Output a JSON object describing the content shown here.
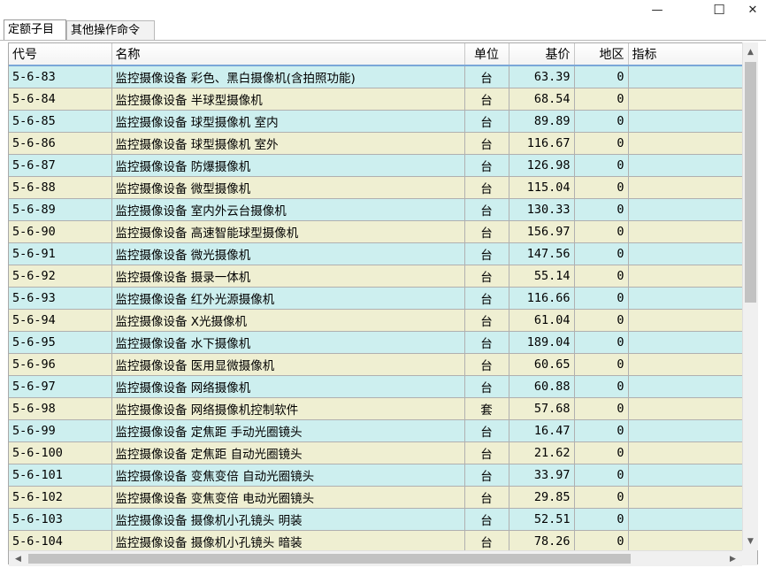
{
  "window": {
    "minimize_glyph": "—",
    "maximize_glyph": "☐",
    "close_glyph": "✕"
  },
  "tabs": [
    {
      "label": "定额子目",
      "active": true
    },
    {
      "label": "其他操作命令",
      "active": false
    }
  ],
  "grid": {
    "columns": [
      "代号",
      "名称",
      "单位",
      "基价",
      "地区",
      "指标"
    ],
    "rows": [
      {
        "code": "5-6-83",
        "name": "监控摄像设备 彩色、黑白摄像机(含拍照功能)",
        "unit": "台",
        "price": "63.39",
        "region": "0",
        "index": ""
      },
      {
        "code": "5-6-84",
        "name": "监控摄像设备 半球型摄像机",
        "unit": "台",
        "price": "68.54",
        "region": "0",
        "index": ""
      },
      {
        "code": "5-6-85",
        "name": "监控摄像设备 球型摄像机 室内",
        "unit": "台",
        "price": "89.89",
        "region": "0",
        "index": ""
      },
      {
        "code": "5-6-86",
        "name": "监控摄像设备 球型摄像机 室外",
        "unit": "台",
        "price": "116.67",
        "region": "0",
        "index": ""
      },
      {
        "code": "5-6-87",
        "name": "监控摄像设备 防爆摄像机",
        "unit": "台",
        "price": "126.98",
        "region": "0",
        "index": ""
      },
      {
        "code": "5-6-88",
        "name": "监控摄像设备 微型摄像机",
        "unit": "台",
        "price": "115.04",
        "region": "0",
        "index": ""
      },
      {
        "code": "5-6-89",
        "name": "监控摄像设备 室内外云台摄像机",
        "unit": "台",
        "price": "130.33",
        "region": "0",
        "index": ""
      },
      {
        "code": "5-6-90",
        "name": "监控摄像设备 高速智能球型摄像机",
        "unit": "台",
        "price": "156.97",
        "region": "0",
        "index": ""
      },
      {
        "code": "5-6-91",
        "name": "监控摄像设备 微光摄像机",
        "unit": "台",
        "price": "147.56",
        "region": "0",
        "index": ""
      },
      {
        "code": "5-6-92",
        "name": "监控摄像设备 摄录一体机",
        "unit": "台",
        "price": "55.14",
        "region": "0",
        "index": ""
      },
      {
        "code": "5-6-93",
        "name": "监控摄像设备 红外光源摄像机",
        "unit": "台",
        "price": "116.66",
        "region": "0",
        "index": ""
      },
      {
        "code": "5-6-94",
        "name": "监控摄像设备 X光摄像机",
        "unit": "台",
        "price": "61.04",
        "region": "0",
        "index": ""
      },
      {
        "code": "5-6-95",
        "name": "监控摄像设备 水下摄像机",
        "unit": "台",
        "price": "189.04",
        "region": "0",
        "index": ""
      },
      {
        "code": "5-6-96",
        "name": "监控摄像设备 医用显微摄像机",
        "unit": "台",
        "price": "60.65",
        "region": "0",
        "index": ""
      },
      {
        "code": "5-6-97",
        "name": "监控摄像设备 网络摄像机",
        "unit": "台",
        "price": "60.88",
        "region": "0",
        "index": ""
      },
      {
        "code": "5-6-98",
        "name": "监控摄像设备 网络摄像机控制软件",
        "unit": "套",
        "price": "57.68",
        "region": "0",
        "index": ""
      },
      {
        "code": "5-6-99",
        "name": "监控摄像设备 定焦距 手动光圈镜头",
        "unit": "台",
        "price": "16.47",
        "region": "0",
        "index": ""
      },
      {
        "code": "5-6-100",
        "name": "监控摄像设备 定焦距 自动光圈镜头",
        "unit": "台",
        "price": "21.62",
        "region": "0",
        "index": ""
      },
      {
        "code": "5-6-101",
        "name": "监控摄像设备 变焦变倍 自动光圈镜头",
        "unit": "台",
        "price": "33.97",
        "region": "0",
        "index": ""
      },
      {
        "code": "5-6-102",
        "name": "监控摄像设备 变焦变倍 电动光圈镜头",
        "unit": "台",
        "price": "29.85",
        "region": "0",
        "index": ""
      },
      {
        "code": "5-6-103",
        "name": "监控摄像设备 摄像机小孔镜头 明装",
        "unit": "台",
        "price": "52.51",
        "region": "0",
        "index": ""
      },
      {
        "code": "5-6-104",
        "name": "监控摄像设备 摄像机小孔镜头 暗装",
        "unit": "台",
        "price": "78.26",
        "region": "0",
        "index": ""
      }
    ]
  },
  "scrollbars": {
    "up_glyph": "▲",
    "down_glyph": "▼",
    "left_glyph": "◀",
    "right_glyph": "▶"
  },
  "colors": {
    "row_odd": "#cdefef",
    "row_even": "#efefd2",
    "header_underline": "#7aa7d8"
  }
}
